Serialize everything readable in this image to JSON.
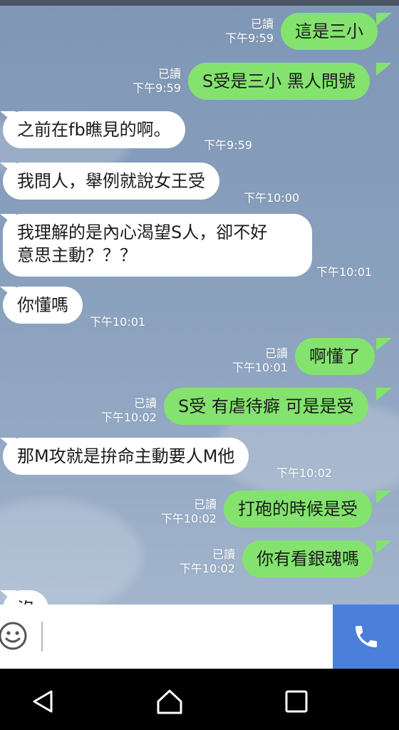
{
  "messages": [
    {
      "dir": "out",
      "text": "這是三小",
      "status": "已讀",
      "time": "下午9:59"
    },
    {
      "dir": "out",
      "text": "S受是三小 黑人問號",
      "status": "已讀",
      "time": "下午9:59"
    },
    {
      "dir": "in",
      "text": "之前在fb瞧見的啊。",
      "time": "下午9:59"
    },
    {
      "dir": "in",
      "text": "我問人，舉例就說女王受",
      "time": "下午10:00"
    },
    {
      "dir": "in",
      "text": "我理解的是內心渴望S人，卻不好意思主動？？？",
      "line1": "我理解的是內心渴望S人，卻不好",
      "line2": "意思主動？？？",
      "time": "下午10:01"
    },
    {
      "dir": "in",
      "text": "你懂嗎",
      "time": "下午10:01"
    },
    {
      "dir": "out",
      "text": "啊懂了",
      "status": "已讀",
      "time": "下午10:01"
    },
    {
      "dir": "out",
      "text": "S受 有虐待癖 可是是受",
      "status": "已讀",
      "time": "下午10:02"
    },
    {
      "dir": "in",
      "text": "那M攻就是拚命主動要人M他",
      "time": "下午10:02"
    },
    {
      "dir": "out",
      "text": "打砲的時候是受",
      "status": "已讀",
      "time": "下午10:02"
    },
    {
      "dir": "out",
      "text": "你有看銀魂嗎",
      "status": "已讀",
      "time": "下午10:02"
    },
    {
      "dir": "in",
      "text": "沒",
      "time": ""
    }
  ],
  "input": {
    "placeholder": ""
  },
  "colors": {
    "outgoing": "#84e36f",
    "incoming": "#ffffff",
    "call": "#4a7fdc",
    "background": "#8aa1bd"
  },
  "icons": {
    "emoji": "emoji-icon",
    "call": "phone-icon",
    "back": "back-icon",
    "home": "home-icon",
    "recents": "recents-icon"
  }
}
